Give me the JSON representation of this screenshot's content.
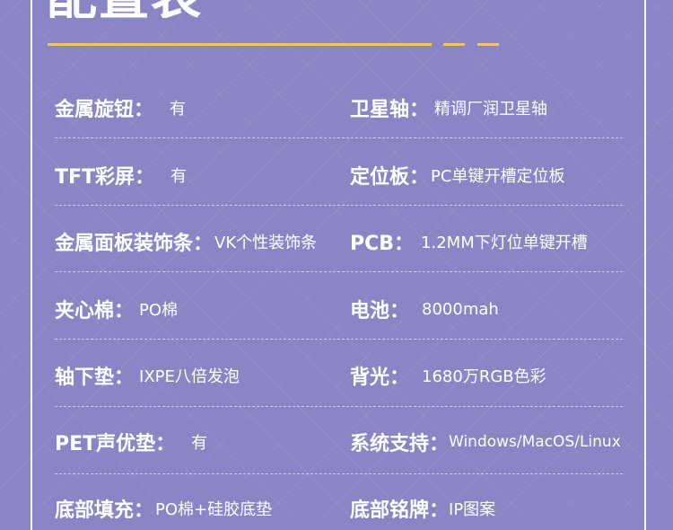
{
  "title": "配置表",
  "specs": [
    {
      "label": "金属旋钮：",
      "value": "有"
    },
    {
      "label": "卫星轴：",
      "value": "精调厂润卫星轴"
    },
    {
      "label": "TFT彩屏：",
      "value": "有"
    },
    {
      "label": "定位板：",
      "value": "PC单键开槽定位板"
    },
    {
      "label": "金属面板装饰条：",
      "value": "VK个性装饰条"
    },
    {
      "label": "PCB：",
      "value": "1.2MM下灯位单键开槽"
    },
    {
      "label": "夹心棉：",
      "value": "PO棉"
    },
    {
      "label": "电池：",
      "value": "8000mah"
    },
    {
      "label": "轴下垫：",
      "value": "IXPE八倍发泡"
    },
    {
      "label": "背光：",
      "value": "1680万RGB色彩"
    },
    {
      "label": "PET声优垫：",
      "value": "有"
    },
    {
      "label": "系统支持：",
      "value": "Windows/MacOS/Linux"
    },
    {
      "label": "底部填充：",
      "value": "PO棉+硅胶底垫"
    },
    {
      "label": "底部铭牌：",
      "value": "IP图案"
    }
  ]
}
